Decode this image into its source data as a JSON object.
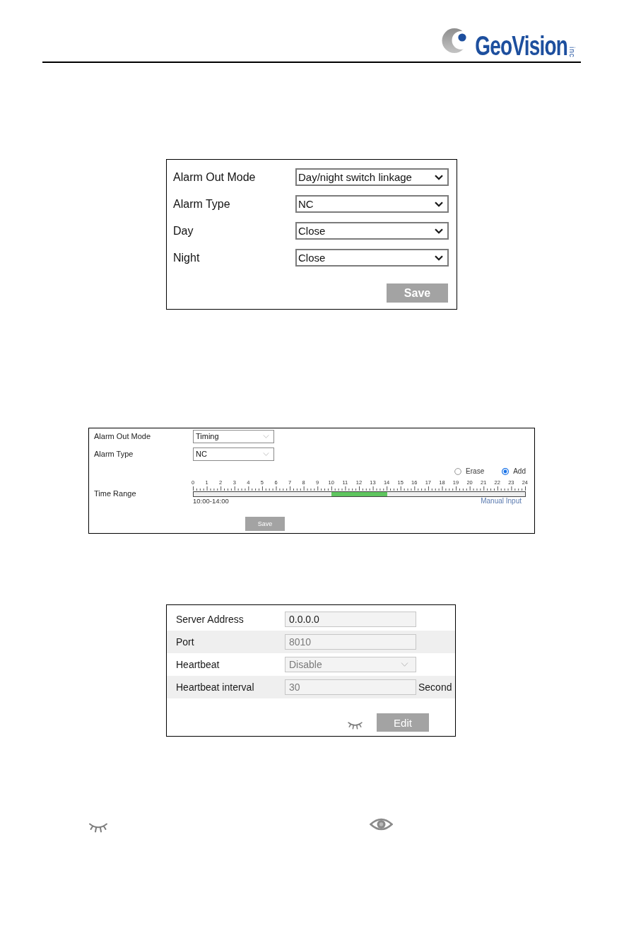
{
  "header": {
    "logo": {
      "text": "GeoVision",
      "suffix": "inc"
    }
  },
  "alarm_out_panel": {
    "fields": [
      {
        "label": "Alarm Out Mode",
        "value": "Day/night switch linkage"
      },
      {
        "label": "Alarm Type",
        "value": "NC"
      },
      {
        "label": "Day",
        "value": "Close"
      },
      {
        "label": "Night",
        "value": "Close"
      }
    ],
    "save_button": "Save"
  },
  "timing_panel": {
    "fields": [
      {
        "label": "Alarm Out Mode",
        "value": "Timing"
      },
      {
        "label": "Alarm Type",
        "value": "NC"
      }
    ],
    "modes": [
      {
        "label": "Erase",
        "selected": false
      },
      {
        "label": "Add",
        "selected": true
      }
    ],
    "time_range": {
      "label": "Time Range",
      "ticks": [
        "0",
        "1",
        "2",
        "3",
        "4",
        "5",
        "6",
        "7",
        "8",
        "9",
        "10",
        "11",
        "12",
        "13",
        "14",
        "15",
        "16",
        "17",
        "18",
        "19",
        "20",
        "21",
        "22",
        "23",
        "24"
      ],
      "hours": [
        {
          "selected": false
        },
        {
          "selected": false
        },
        {
          "selected": false
        },
        {
          "selected": false
        },
        {
          "selected": false
        },
        {
          "selected": false
        },
        {
          "selected": false
        },
        {
          "selected": false
        },
        {
          "selected": false
        },
        {
          "selected": false
        },
        {
          "selected": true
        },
        {
          "selected": true
        },
        {
          "selected": true
        },
        {
          "selected": true
        },
        {
          "selected": false
        },
        {
          "selected": false
        },
        {
          "selected": false
        },
        {
          "selected": false
        },
        {
          "selected": false
        },
        {
          "selected": false
        },
        {
          "selected": false
        },
        {
          "selected": false
        },
        {
          "selected": false
        },
        {
          "selected": false
        }
      ],
      "range_text": "10:00-14:00",
      "manual_input": "Manual Input"
    },
    "save_button": "Save"
  },
  "server_panel": {
    "fields": [
      {
        "kind": "text",
        "label": "Server Address",
        "value": "0.0.0.0",
        "disabled": false
      },
      {
        "kind": "text",
        "label": "Port",
        "value": "8010",
        "disabled": true
      },
      {
        "kind": "select",
        "label": "Heartbeat",
        "value": "Disable",
        "disabled": true
      },
      {
        "kind": "text",
        "label": "Heartbeat interval",
        "value": "30",
        "disabled": true,
        "unit": "Second"
      }
    ],
    "edit_button": "Edit"
  }
}
